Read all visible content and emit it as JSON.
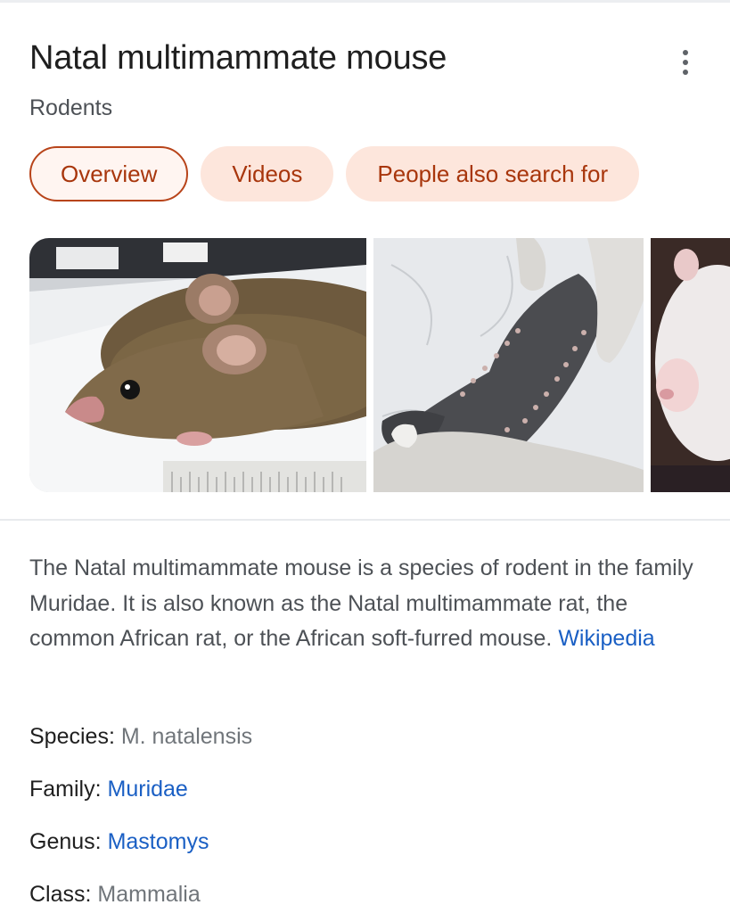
{
  "header": {
    "title": "Natal multimammate mouse",
    "subtitle": "Rodents"
  },
  "tabs": [
    {
      "label": "Overview",
      "active": true
    },
    {
      "label": "Videos",
      "active": false
    },
    {
      "label": "People also search for",
      "active": false
    }
  ],
  "icons": {
    "menu": "more-vertical-icon"
  },
  "description": {
    "text": "The Natal multimammate mouse is a species of rodent in the family Muridae. It is also known as the Natal multimammate rat, the common African rat, or the African soft-furred mouse.",
    "source_link": "Wikipedia"
  },
  "facts": [
    {
      "label": "Species:",
      "value": "M. natalensis",
      "is_link": false
    },
    {
      "label": "Family:",
      "value": "Muridae",
      "is_link": true
    },
    {
      "label": "Genus:",
      "value": "Mastomys",
      "is_link": true
    },
    {
      "label": "Class:",
      "value": "Mammalia",
      "is_link": false
    }
  ],
  "colors": {
    "tab_text": "#a8360c",
    "tab_background": "#fde6dc",
    "tab_active_border": "#b8441a",
    "link": "#1a5fc4",
    "muted_text": "#70757a"
  }
}
